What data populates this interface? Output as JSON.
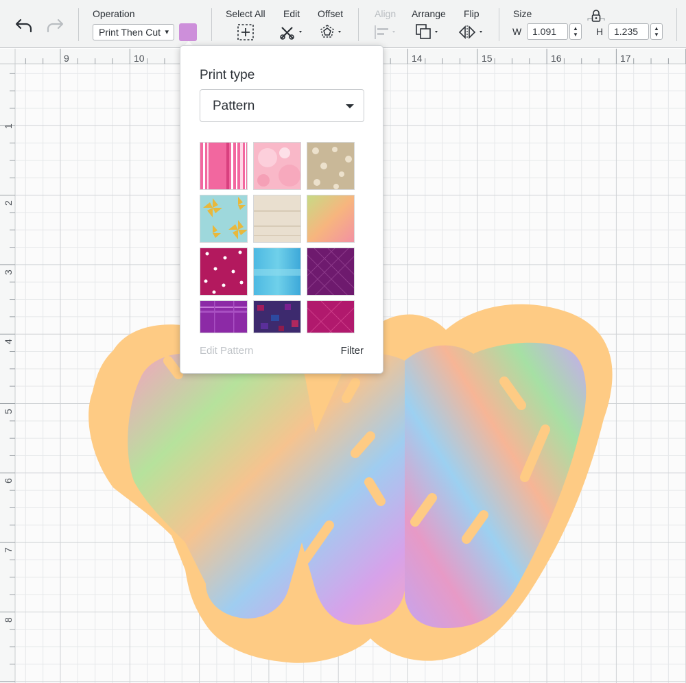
{
  "toolbar": {
    "undo_icon": "undo-icon",
    "redo_icon": "redo-icon",
    "operation_label": "Operation",
    "operation_value": "Print Then Cut",
    "operation_caret": "▾",
    "operation_color": "#cd8fda",
    "select_all_label": "Select All",
    "edit_label": "Edit",
    "offset_label": "Offset",
    "align_label": "Align",
    "arrange_label": "Arrange",
    "flip_label": "Flip",
    "size_label": "Size",
    "width_label": "W",
    "width_value": "1.091",
    "height_label": "H",
    "height_value": "1.235",
    "step_up": "▲",
    "step_down": "▼",
    "lock_icon": "lock-icon"
  },
  "ruler": {
    "x_labels": [
      "9",
      "10",
      "14",
      "15",
      "16",
      "17"
    ],
    "y_labels": [
      "1",
      "2",
      "3",
      "4",
      "5",
      "6",
      "7",
      "8"
    ]
  },
  "popup": {
    "title": "Print type",
    "print_type_value": "Pattern",
    "edit_pattern": "Edit Pattern",
    "filter": "Filter",
    "patterns": [
      "pink-stripes",
      "pink-texture",
      "beige-floral",
      "pinwheel",
      "wood-grain",
      "gradient-peach",
      "magenta-dots",
      "blue-watercolor",
      "purple-crosshatch",
      "purple-plaid",
      "jewel-mosaic",
      "magenta-crosshatch"
    ]
  },
  "colors": {
    "offset_fill": "#fecb84",
    "grid_major": "#cfd2d5",
    "grid_minor": "#e6e8ea"
  }
}
